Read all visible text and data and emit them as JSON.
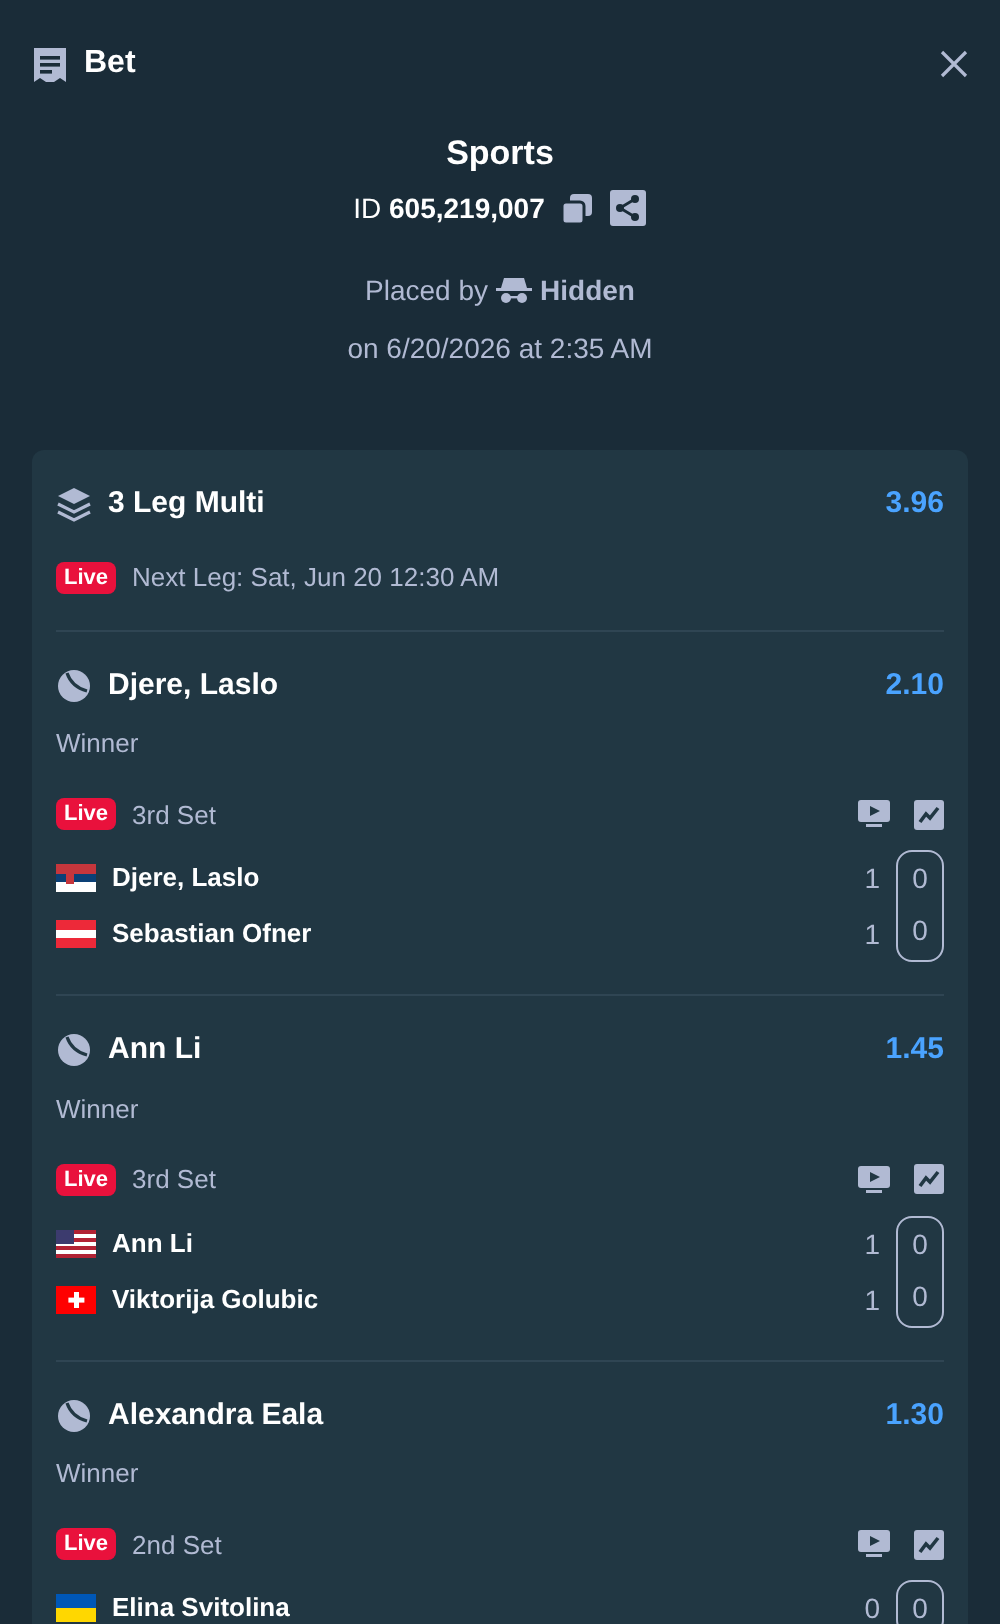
{
  "header": {
    "title": "Bet"
  },
  "bet": {
    "sport": "Sports",
    "id_label": "ID",
    "id": "605,219,007",
    "placed_by": "Placed by",
    "user": "Hidden",
    "placed_on": "on 6/20/2026 at 2:35 AM"
  },
  "multi": {
    "title": "3 Leg Multi",
    "odds": "3.96",
    "live": "Live",
    "next_leg": "Next Leg: Sat, Jun 20 12:30 AM"
  },
  "legs": [
    {
      "selection": "Djere, Laslo",
      "odds": "2.10",
      "market": "Winner",
      "live": "Live",
      "period": "3rd Set",
      "players": [
        {
          "name": "Djere, Laslo",
          "kind": "rs",
          "sets": "1",
          "games": "0"
        },
        {
          "name": "Sebastian Ofner",
          "kind": "at",
          "sets": "1",
          "games": "0"
        }
      ]
    },
    {
      "selection": "Ann Li",
      "odds": "1.45",
      "market": "Winner",
      "live": "Live",
      "period": "3rd Set",
      "players": [
        {
          "name": "Ann Li",
          "kind": "us",
          "sets": "1",
          "games": "0"
        },
        {
          "name": "Viktorija Golubic",
          "kind": "ch",
          "sets": "1",
          "games": "0"
        }
      ]
    },
    {
      "selection": "Alexandra Eala",
      "odds": "1.30",
      "market": "Winner",
      "live": "Live",
      "period": "2nd Set",
      "players": [
        {
          "name": "Elina Svitolina",
          "kind": "ua",
          "sets": "0",
          "games": "0"
        }
      ]
    }
  ]
}
